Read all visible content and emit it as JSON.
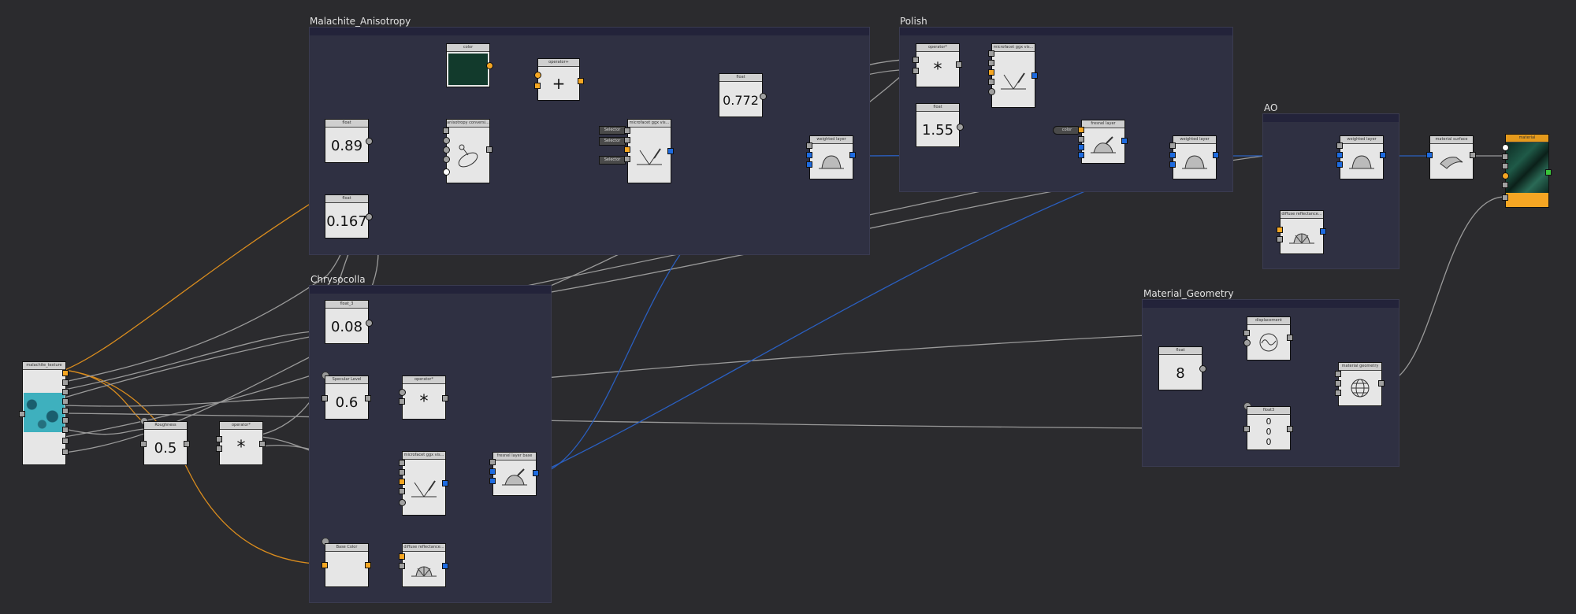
{
  "groups": {
    "malachite": "Malachite_Anisotropy",
    "polish": "Polish",
    "ao": "AO",
    "chrysocolla": "Chrysocolla",
    "geometry": "Material_Geometry"
  },
  "nodes": {
    "color": "color",
    "operator_plus": "operator+",
    "float_089_label": "float",
    "float_089_value": "0.89",
    "float_0167_label": "float",
    "float_0167_value": "0.167",
    "anisotropy": "anisotropy conversi...",
    "specular_ggx_malachite": "microfacet ggx vis...",
    "selector_1": "Selector",
    "selector_2": "Selector",
    "selector_3": "Selector",
    "float_0772_label": "float",
    "float_0772_value": "0.772",
    "weighted_malachite": "weighted layer",
    "operator_mul_polish": "operator*",
    "specular_ggx_polish": "microfacet ggx vis...",
    "float_155_label": "float",
    "float_155_value": "1.55",
    "color_polish": "color",
    "fresnel_layer": "fresnel layer",
    "weighted_polish": "weighted layer",
    "weighted_ao": "weighted layer",
    "diffuse_ao": "diffuse reflectance...",
    "material_surface": "material surface",
    "material": "material",
    "float3_label": "float_3",
    "float3_value": "0.08",
    "specular_level_label": "Specular Level",
    "specular_level_value": "0.6",
    "operator_mul_chrys": "operator*",
    "texture_label": "malachite_texture",
    "roughness_label": "Roughness",
    "roughness_value": "0.5",
    "operator_mul_rough": "operator*",
    "specular_ggx_chrys": "microfacet ggx vis...",
    "fresnel_chrys": "fresnel layer base",
    "base_color": "Base Color",
    "diffuse_chrys": "diffuse reflectance...",
    "displacement": "displacement",
    "float_8_label": "float",
    "float_8_value": "8",
    "float3_geo_label": "float3",
    "float3_geo_values": [
      "0",
      "0",
      "0"
    ],
    "material_geometry": "material geometry"
  },
  "colors": {
    "background": "#2b2b2e",
    "group": "#2f3042",
    "node": "#e6e6e6",
    "port_orange": "#f5a623",
    "port_blue": "#1e6be0",
    "port_gray": "#a0a0a0",
    "wire_gray": "#9a9a9a",
    "wire_orange": "#d98c1e",
    "wire_blue": "#2a5fc0",
    "malachite_green": "#123a2c",
    "chrysocolla_teal": "#3a9aa8"
  },
  "icons": {
    "plus": "plus-operator-icon",
    "multiply": "asterisk-operator-icon",
    "specular": "specular-lobe-icon",
    "weighted": "dome-layer-icon",
    "fresnel": "fresnel-lobe-icon",
    "diffuse": "diffuse-lobe-icon",
    "surface": "surface-sheet-icon",
    "displacement": "wave-circle-icon",
    "geometry": "sphere-grid-icon",
    "anisotropy": "ellipse-arrow-icon"
  }
}
